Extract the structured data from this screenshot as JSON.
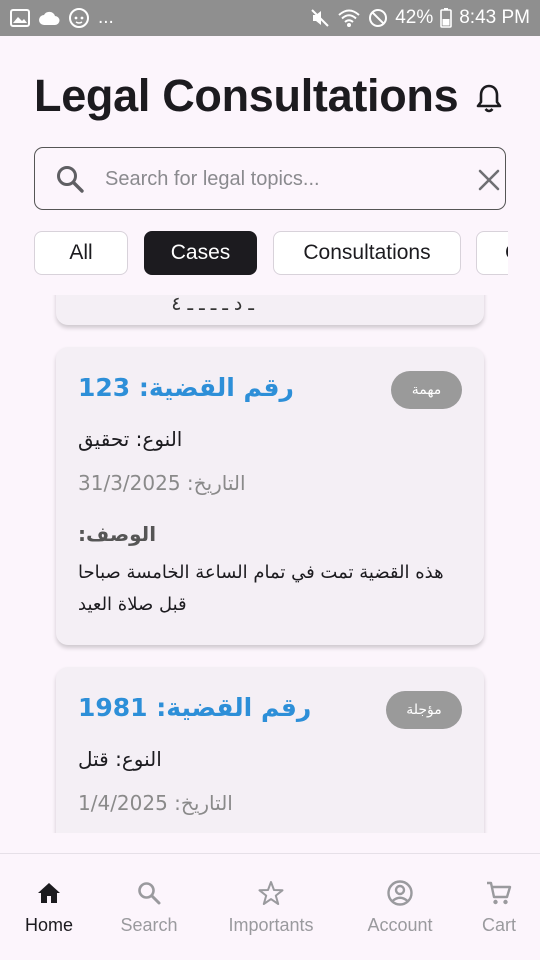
{
  "status_bar": {
    "time": "8:43 PM",
    "battery": "42%",
    "overflow": "...",
    "left_icons": [
      "image-icon",
      "cloud-icon",
      "baby-face-icon"
    ],
    "right_icons": [
      "mute-icon",
      "wifi-icon",
      "do-not-disturb-icon",
      "battery-icon"
    ]
  },
  "header": {
    "title": "Legal Consultations",
    "bell_icon": "bell-icon"
  },
  "search": {
    "placeholder": "Search for legal topics...",
    "value": "",
    "search_icon": "search-icon",
    "clear_icon": "close-icon"
  },
  "filters": [
    {
      "label": "All",
      "selected": false
    },
    {
      "label": "Cases",
      "selected": true
    },
    {
      "label": "Consultations",
      "selected": false
    },
    {
      "label": "C",
      "selected": false
    }
  ],
  "cases": {
    "partial_card_text": "ـ د ـ ـ ـ ـ ٤",
    "items": [
      {
        "title": "رقم القضية: 123",
        "badge": "مهمة",
        "type": "النوع: تحقيق",
        "date": "التاريخ: 31/3/2025",
        "description_label": "الوصف:",
        "description": "هذه القضية تمت في تمام الساعة الخامسة صباحا قبل صلاة العيد"
      },
      {
        "title": "رقم القضية: 1981",
        "badge": "مؤجلة",
        "type": "النوع: قتل",
        "date": "التاريخ: 1/4/2025"
      }
    ]
  },
  "bottom_nav": [
    {
      "label": "Home",
      "icon": "home-icon",
      "active": true
    },
    {
      "label": "Search",
      "icon": "search-icon",
      "active": false
    },
    {
      "label": "Importants",
      "icon": "star-icon",
      "active": false
    },
    {
      "label": "Account",
      "icon": "account-icon",
      "active": false
    },
    {
      "label": "Cart",
      "icon": "cart-icon",
      "active": false
    }
  ],
  "colors": {
    "accent_blue": "#2d8fd8",
    "badge_gray": "#9a9a9a",
    "selected_chip": "#1c1b1f",
    "background": "#fcf5fc",
    "card": "#f4eff5"
  }
}
